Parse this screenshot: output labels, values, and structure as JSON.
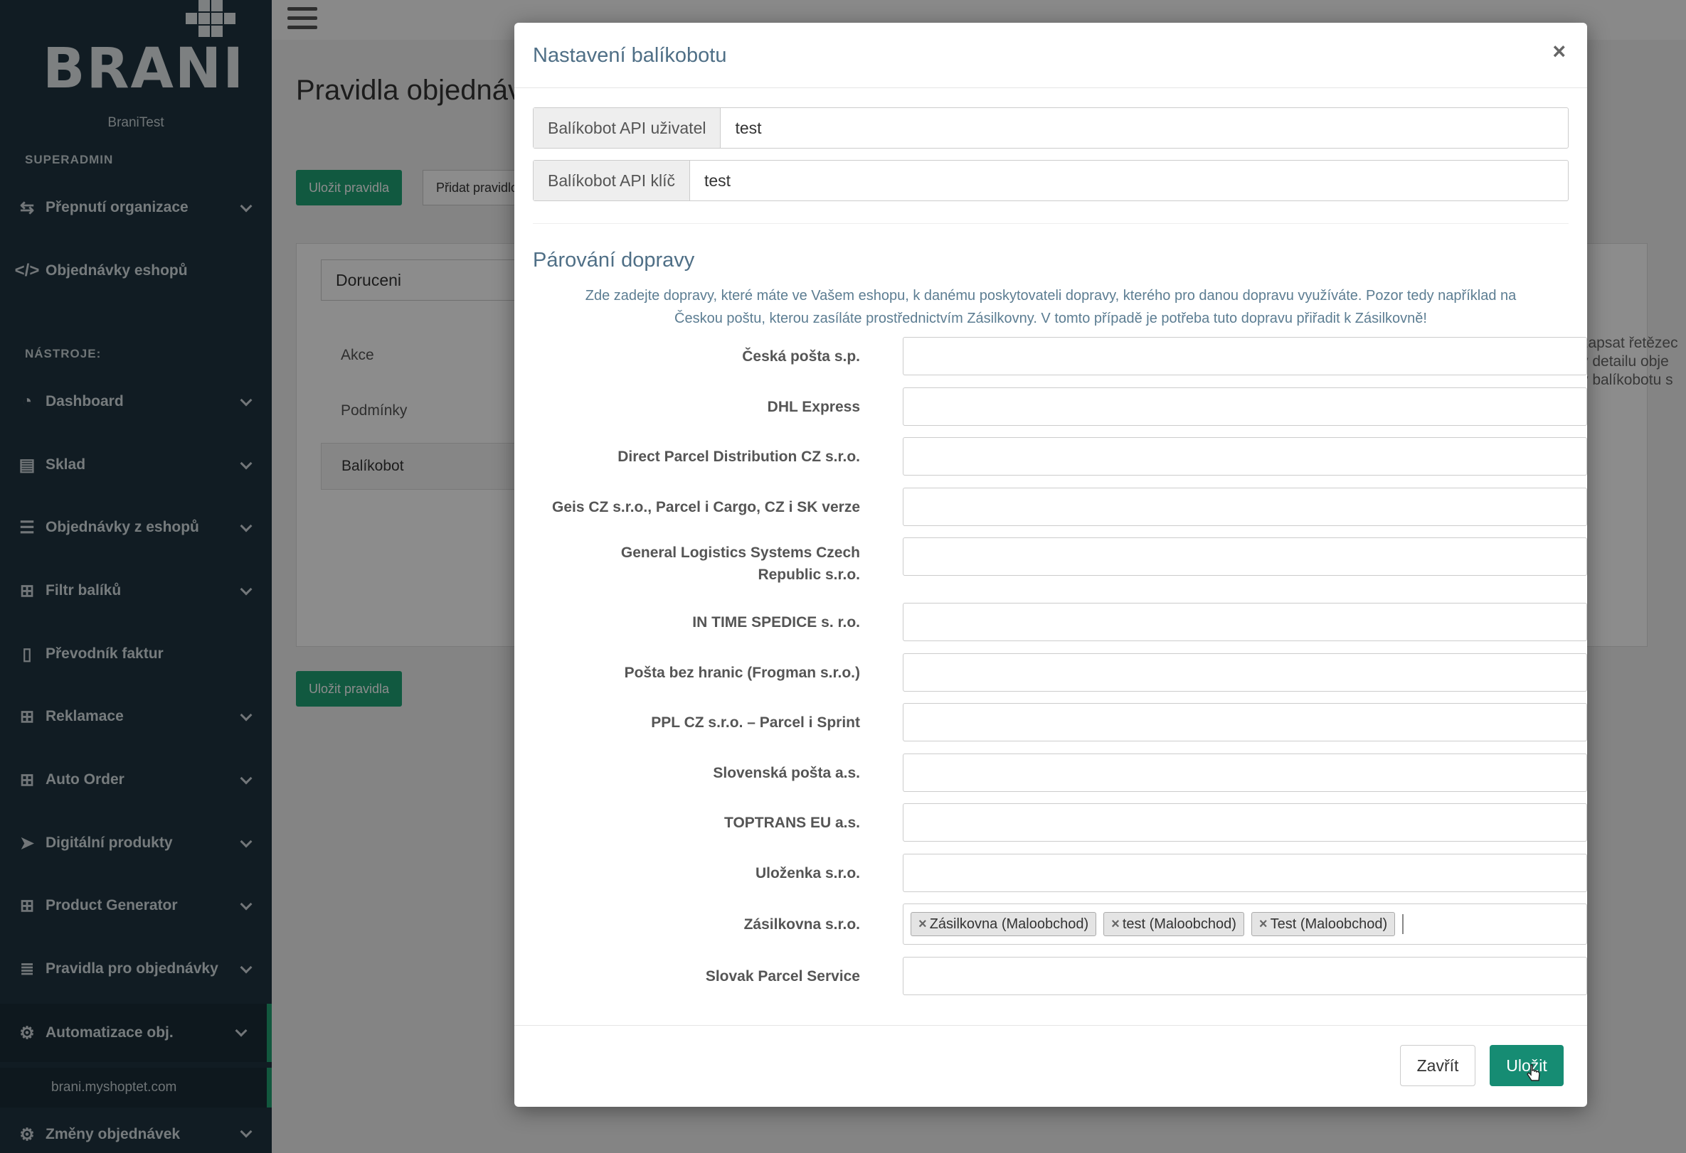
{
  "sidebar": {
    "logo": "BRANI",
    "org": "BraniTest",
    "superadmin_label": "SUPERADMIN",
    "tools_label": "NÁSTROJE:",
    "items": [
      {
        "label": "Přepnutí organizace",
        "icon": "switch-icon"
      },
      {
        "label": "Objednávky eshopů",
        "icon": "code-icon"
      },
      {
        "label": "Dashboard",
        "icon": "dashboard-icon"
      },
      {
        "label": "Sklad",
        "icon": "building-icon"
      },
      {
        "label": "Objednávky z eshopů",
        "icon": "list-icon"
      },
      {
        "label": "Filtr balíků",
        "icon": "gift-icon"
      },
      {
        "label": "Převodník faktur",
        "icon": "file-icon"
      },
      {
        "label": "Reklamace",
        "icon": "gift-icon"
      },
      {
        "label": "Auto Order",
        "icon": "gift-icon"
      },
      {
        "label": "Digitální produkty",
        "icon": "send-icon"
      },
      {
        "label": "Product Generator",
        "icon": "gift-icon"
      },
      {
        "label": "Pravidla pro objednávky",
        "icon": "server-icon"
      },
      {
        "label": "Automatizace obj.",
        "icon": "gears-icon"
      },
      {
        "label": "Změny objednávek",
        "icon": "gears-icon"
      }
    ],
    "sub_item": "brani.myshoptet.com"
  },
  "main": {
    "title": "Pravidla objednávek",
    "save_rules": "Uložit pravidla",
    "add_rule": "Přidat pravidlo",
    "field": "Doruceni",
    "tabs": [
      "Akce",
      "Podmínky",
      "Balíkobot"
    ],
    "right_text": [
      "zapsat řetězec",
      "v detailu obje",
      "v balíkobotu s"
    ]
  },
  "modal": {
    "title": "Nastavení balíkobotu",
    "close_x": "×",
    "api_user_label": "Balíkobot API uživatel",
    "api_user_value": "test",
    "api_key_label": "Balíkobot API klíč",
    "api_key_value": "test",
    "section_title": "Párování dopravy",
    "help_line1": "Zde zadejte dopravy, které máte ve Vašem eshopu, k danému poskytovateli dopravy, kterého pro danou dopravu využíváte. Pozor tedy například na",
    "help_line2": "Českou poštu, kterou zasíláte prostřednictvím Zásilkovny. V tomto případě je potřeba tuto dopravu přiřadit k Zásilkovně!",
    "carriers": [
      "Česká pošta s.p.",
      "DHL Express",
      "Direct Parcel Distribution CZ s.r.o.",
      "Geis CZ s.r.o., Parcel i Cargo, CZ i SK verze",
      "General Logistics Systems Czech Republic s.r.o.",
      "IN TIME SPEDICE s. r.o.",
      "Pošta bez hranic (Frogman s.r.o.)",
      "PPL CZ s.r.o. – Parcel i Sprint",
      "Slovenská pošta a.s.",
      "TOPTRANS EU a.s.",
      "Uloženka s.r.o.",
      "Zásilkovna s.r.o.",
      "Slovak Parcel Service"
    ],
    "zasilkovna_tags": [
      "Zásilkovna (Maloobchod)",
      "test (Maloobchod)",
      "Test (Maloobchod)"
    ],
    "tag_remove": "×",
    "close_button": "Zavřít",
    "save_button": "Uložit"
  },
  "colors": {
    "sidebar_bg": "#1f3440",
    "accent": "#1fa276",
    "modal_title": "#4f6f86"
  }
}
